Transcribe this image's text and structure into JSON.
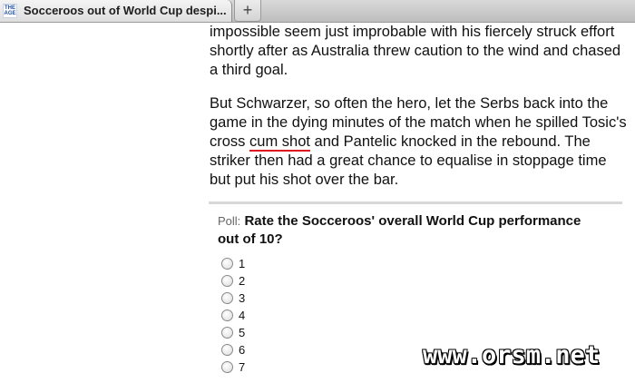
{
  "browser": {
    "tab_title": "Socceroos out of World Cup despi...",
    "favicon_text": "THE AGE",
    "new_tab_label": "+"
  },
  "article": {
    "p1": "impossible seem just improbable with his fiercely struck effort shortly after as Australia threw caution to the wind and chased a third goal.",
    "p2_before": "But Schwarzer, so often the hero, let the Serbs back into the game in the dying minutes of the match when he spilled Tosic's cross ",
    "p2_underlined": "cum shot",
    "p2_after": " and Pantelic knocked in the rebound. The striker then had a great chance to equalise in stoppage time but put his shot over the bar."
  },
  "poll": {
    "prefix": "Poll:",
    "question": "Rate the Socceroos' overall World Cup performance out of 10?",
    "options": [
      "1",
      "2",
      "3",
      "4",
      "5",
      "6",
      "7"
    ]
  },
  "watermark": "www.orsm.net",
  "colors": {
    "spell_underline": "#e0141f"
  }
}
